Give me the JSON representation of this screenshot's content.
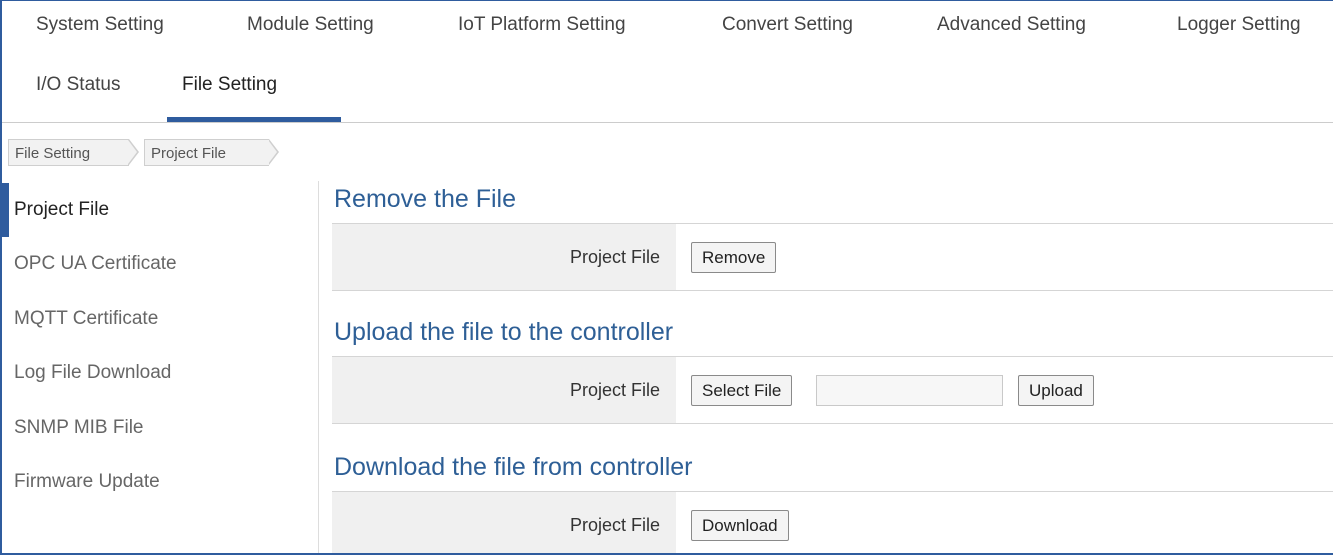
{
  "nav": {
    "row1": [
      "System Setting",
      "Module Setting",
      "IoT Platform Setting",
      "Convert Setting",
      "Advanced Setting",
      "Logger Setting"
    ],
    "row2": [
      "I/O Status",
      "File Setting"
    ]
  },
  "breadcrumb": [
    "File Setting",
    "Project File"
  ],
  "sidebar": {
    "items": [
      "Project File",
      "OPC UA Certificate",
      "MQTT Certificate",
      "Log File Download",
      "SNMP MIB File",
      "Firmware Update"
    ]
  },
  "sections": {
    "remove": {
      "title": "Remove the File",
      "label": "Project File",
      "button": "Remove"
    },
    "upload": {
      "title": "Upload the file to the controller",
      "label": "Project File",
      "select_button": "Select File",
      "file_name": "",
      "upload_button": "Upload"
    },
    "download": {
      "title": "Download the file from controller",
      "label": "Project File",
      "button": "Download"
    }
  },
  "colors": {
    "accent": "#2f5c9e",
    "section_title": "#2e5f96",
    "label_bg": "#f0f0f0"
  }
}
